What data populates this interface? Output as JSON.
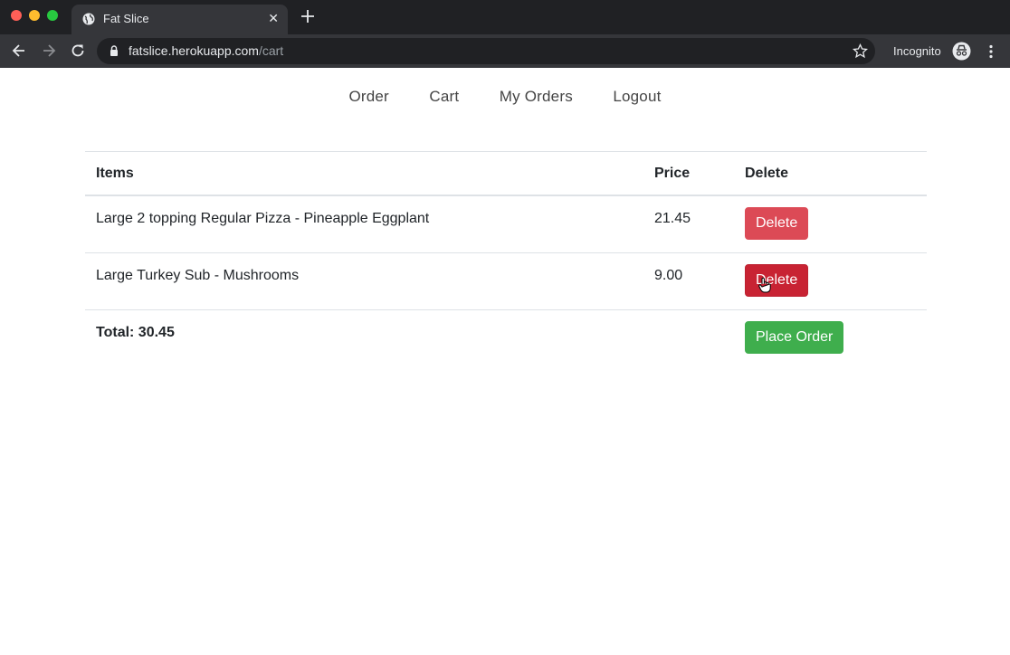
{
  "browser": {
    "tab_title": "Fat Slice",
    "url_host": "fatslice.herokuapp.com",
    "url_path": "/cart",
    "profile_label": "Incognito"
  },
  "nav": {
    "items": [
      "Order",
      "Cart",
      "My Orders",
      "Logout"
    ]
  },
  "cart": {
    "headers": {
      "items": "Items",
      "price": "Price",
      "delete": "Delete"
    },
    "rows": [
      {
        "item": "Large 2 topping Regular Pizza - Pineapple Eggplant",
        "price": "21.45",
        "delete_label": "Delete"
      },
      {
        "item": "Large Turkey Sub - Mushrooms",
        "price": "9.00",
        "delete_label": "Delete"
      }
    ],
    "total_label": "Total: 30.45",
    "place_order_label": "Place Order"
  },
  "colors": {
    "danger": "#dc4a56",
    "success": "#3fae4d",
    "chrome_dark": "#202124"
  }
}
